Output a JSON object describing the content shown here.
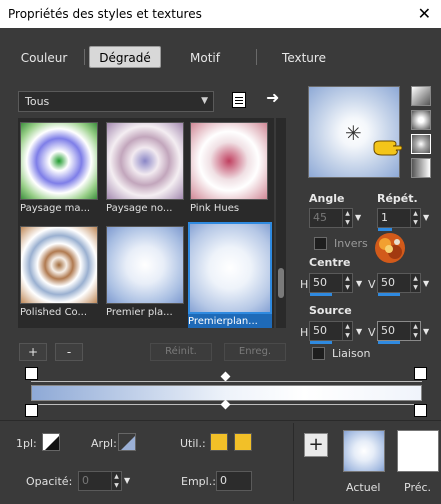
{
  "window": {
    "title": "Propriétés des styles et textures",
    "close": "✕"
  },
  "tabs": [
    {
      "label": "Couleur",
      "active": false
    },
    {
      "label": "Dégradé",
      "active": true
    },
    {
      "label": "Motif",
      "active": false
    },
    {
      "label": "Texture",
      "active": false
    }
  ],
  "category": {
    "selected": "Tous"
  },
  "gradients": [
    {
      "label": "Paysage ma...",
      "selected": false
    },
    {
      "label": "Paysage no...",
      "selected": false
    },
    {
      "label": "Pink Hues",
      "selected": false
    },
    {
      "label": "Polished Co...",
      "selected": false
    },
    {
      "label": "Premier pla...",
      "selected": false
    },
    {
      "label": "Premierplan...",
      "selected": true
    }
  ],
  "list_buttons": {
    "add": "+",
    "remove": "-",
    "reset": "Réinit.",
    "save": "Enreg."
  },
  "angle": {
    "label": "Angle",
    "value": "45"
  },
  "repeat": {
    "label": "Répét.",
    "value": "1"
  },
  "invert": {
    "label": "Invers"
  },
  "center": {
    "label": "Centre",
    "h_label": "H",
    "h_value": "50",
    "v_label": "V",
    "v_value": "50"
  },
  "source": {
    "label": "Source",
    "h_label": "H",
    "h_value": "50",
    "v_label": "V",
    "v_value": "50"
  },
  "link": {
    "label": "Liaison"
  },
  "bottom": {
    "pl_label": "1pl:",
    "arpl_label": "Arpl:",
    "util_label": "Util.:",
    "opacity_label": "Opacité:",
    "opacity_value": "0",
    "empl_label": "Empl.:",
    "empl_value": "0",
    "current_label": "Actuel",
    "previous_label": "Préc."
  },
  "colors": {
    "accent": "#2f8ae0",
    "util_swatch": "#f2c028"
  }
}
